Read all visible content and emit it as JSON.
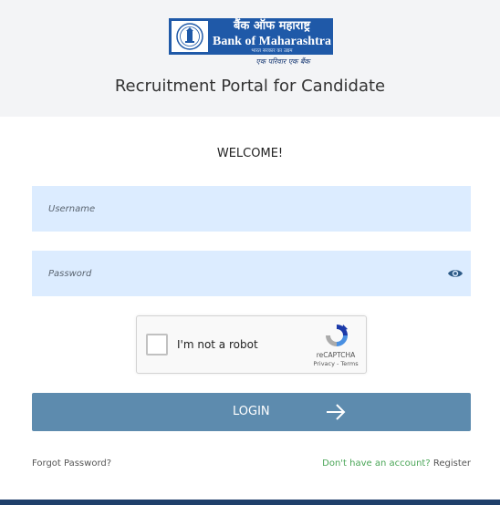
{
  "header": {
    "logo": {
      "hindi_name": "बैंक ऑफ महाराष्ट्र",
      "english_name": "Bank of Maharashtra",
      "subtitle": "भारत सरकार का उद्यम",
      "tagline": "एक परिवार एक बैंक"
    },
    "portal_title": "Recruitment Portal for Candidate"
  },
  "form": {
    "welcome": "WELCOME!",
    "username": {
      "placeholder": "Username",
      "value": ""
    },
    "password": {
      "placeholder": "Password",
      "value": ""
    },
    "show_password_icon": "eye-icon",
    "recaptcha": {
      "label": "I'm not a robot",
      "brand": "reCAPTCHA",
      "links": "Privacy - Terms",
      "checked": false
    },
    "login_button": {
      "label": "LOGIN",
      "icon": "arrow-right-icon"
    },
    "forgot_password": "Forgot Password?",
    "signup_prompt": "Don't have an account?",
    "register_link": "Register"
  },
  "colors": {
    "brand_blue": "#1f59a8",
    "field_bg": "#dcecff",
    "button_bg": "#5d8bae",
    "signup_green": "#4aa657",
    "bottom_bar": "#1f3f6a"
  }
}
